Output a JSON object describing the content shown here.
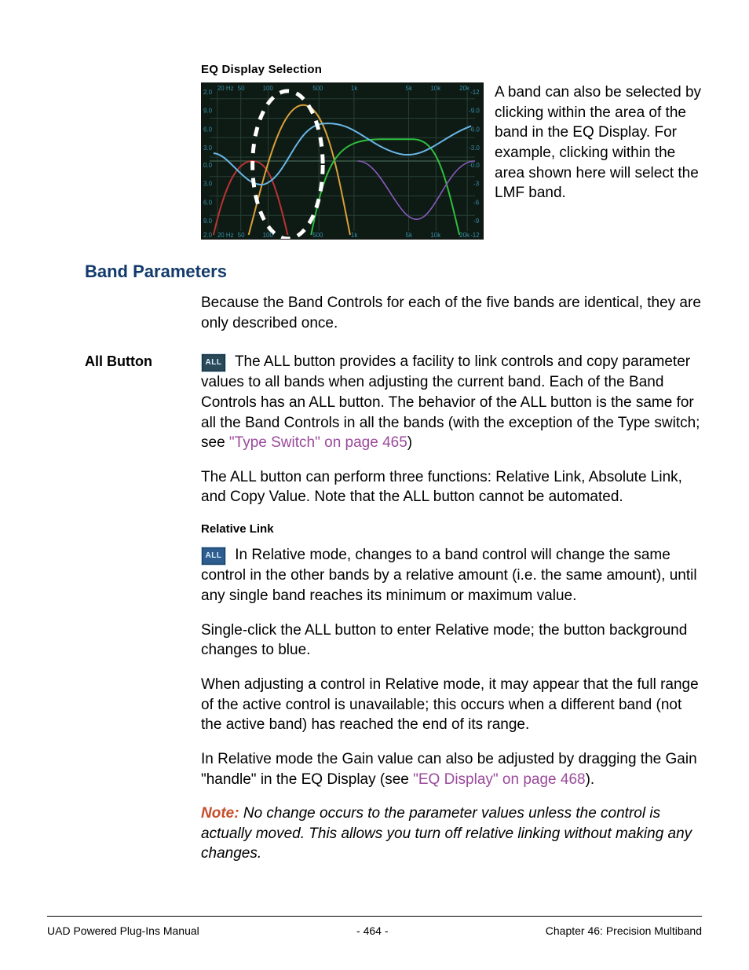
{
  "eq_section": {
    "heading": "EQ Display Selection",
    "side_text": "A band can also be selected by clicking within the area of the band in the EQ Display. For example, clicking within the area shown here will select the LMF band.",
    "x_ticks": [
      "20 Hz",
      "50",
      "100",
      "500",
      "1k",
      "5k",
      "10k",
      "20k"
    ],
    "y_left": [
      "2.0",
      "9.0",
      "6.0",
      "3.0",
      "0.0",
      "3.0",
      "6.0",
      "9.0",
      "2.0"
    ],
    "y_right": [
      "-12",
      "-9.0",
      "-6.0",
      "-3.0",
      "-0.0",
      "-3",
      "-6",
      "-9",
      "-12"
    ]
  },
  "band_params": {
    "heading": "Band Parameters",
    "intro": "Because the Band Controls for each of the five bands are identical, they are only described once."
  },
  "all_button": {
    "label": "All Button",
    "icon_text": "ALL",
    "p1_lead": "The ALL button provides a facility to link controls and copy parameter ",
    "p1_rest": "values to all bands when adjusting the current band. Each of the Band Controls has an ALL button. The behavior of the ALL button is the same for all the Band Controls in all the bands (with the exception of the Type switch; see ",
    "xref1": "\"Type Switch\" on page 465",
    "p1_close": ")",
    "p2": "The ALL button can perform three functions: Relative Link, Absolute Link, and Copy Value. Note that the ALL button cannot be automated."
  },
  "relative_link": {
    "heading": "Relative Link",
    "icon_text": "ALL",
    "p1_lead": "In Relative mode, changes to a band control will change the same con",
    "p1_rest": "trol in the other bands by a relative amount (i.e. the same amount), until any single band reaches its minimum or maximum value.",
    "p2": "Single-click the ALL button to enter Relative mode; the button background changes to blue.",
    "p3": "When adjusting a control in Relative mode, it may appear that the full range of the active control is unavailable; this occurs when a different band (not the active band) has reached the end of its range.",
    "p4a": "In Relative mode the Gain value can also be adjusted by dragging the Gain \"handle\" in the EQ Display (see ",
    "xref2": "\"EQ Display\" on page 468",
    "p4b": ").",
    "note_label": "Note:",
    "note_text": " No change occurs to the parameter values unless the control is actually moved. This allows you turn off relative linking without making any changes."
  },
  "footer": {
    "left": "UAD Powered Plug-Ins Manual",
    "center": "- 464 -",
    "right": "Chapter 46: Precision Multiband"
  }
}
